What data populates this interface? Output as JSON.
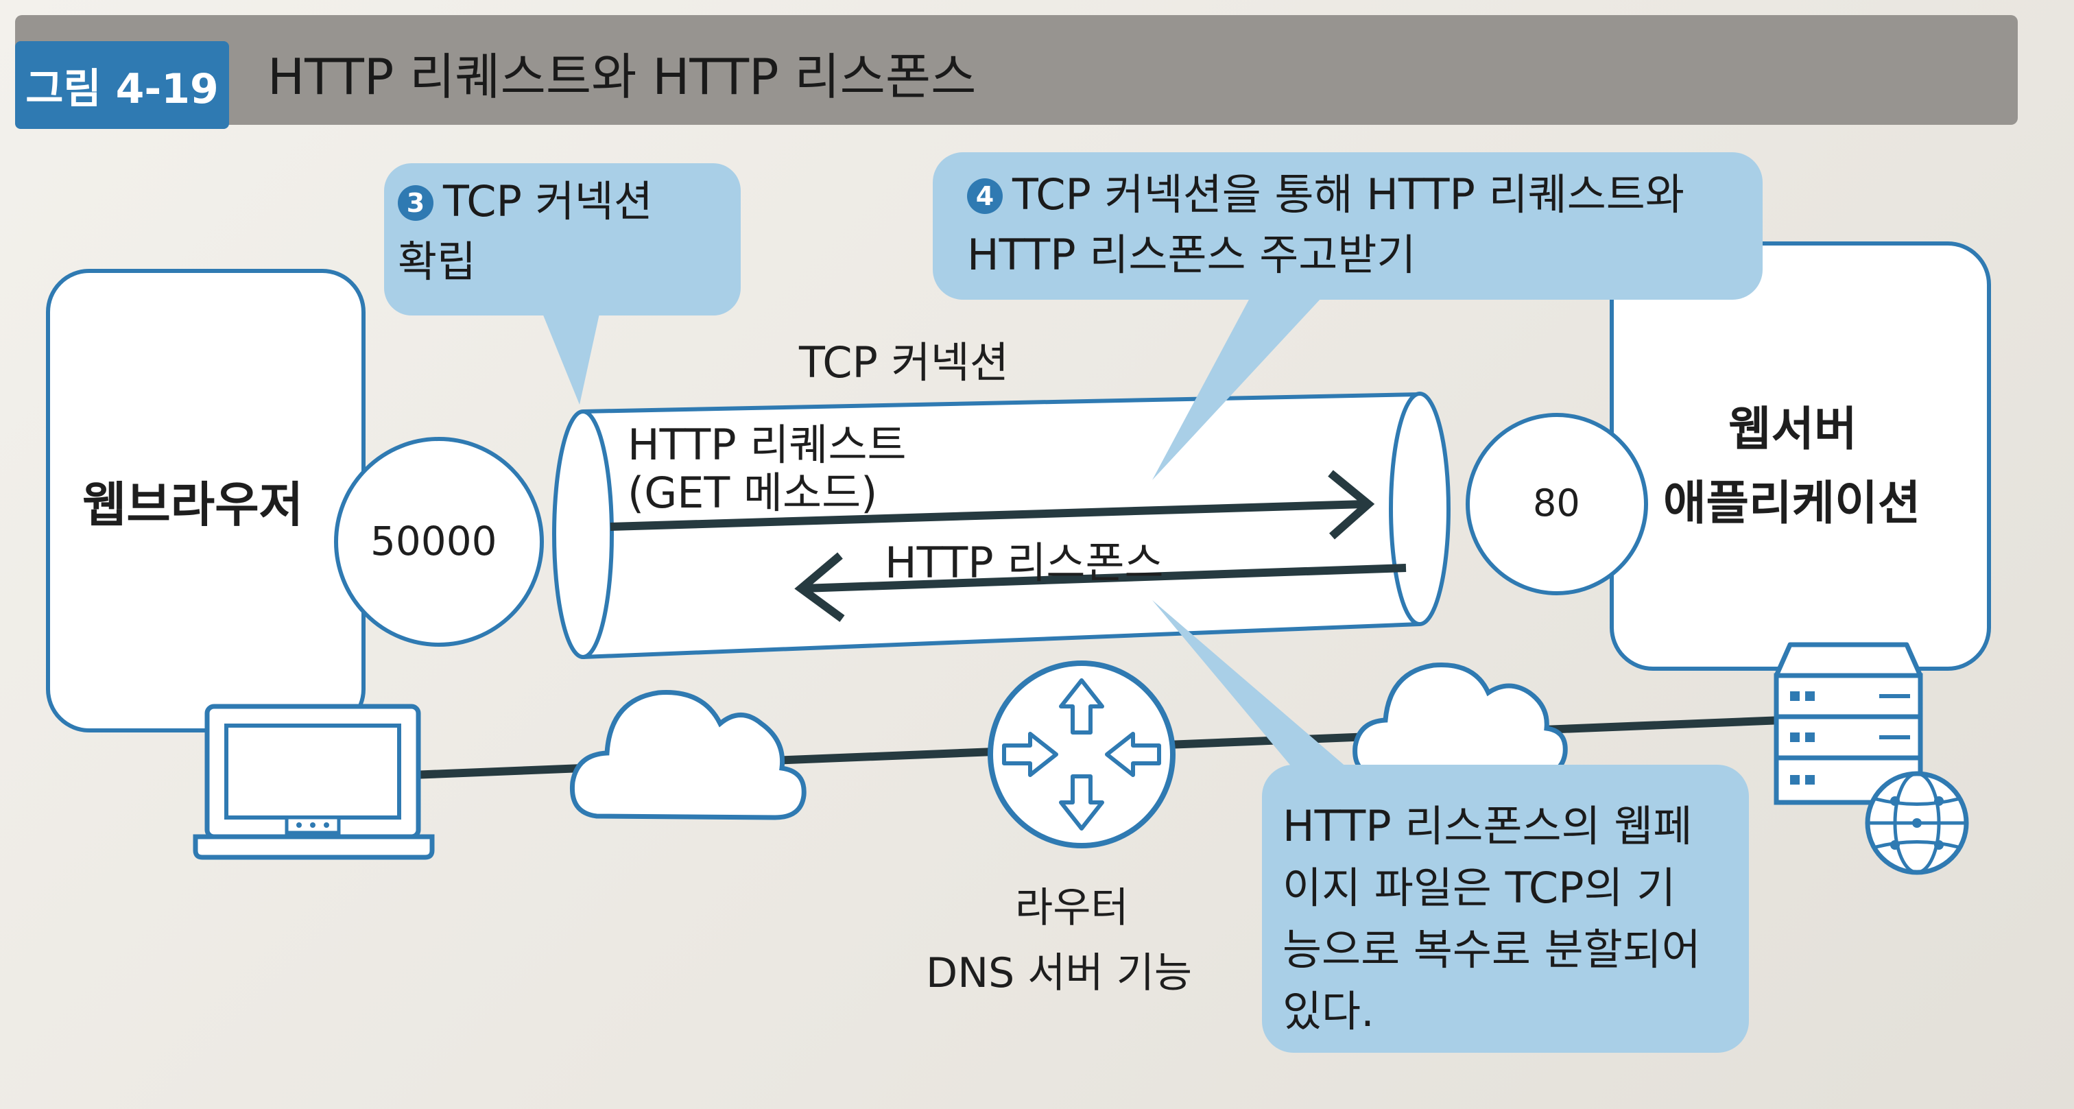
{
  "figure": {
    "label": "그림 4-19",
    "title": "HTTP 리퀘스트와 HTTP 리스폰스"
  },
  "browser": {
    "label": "웹브라우저",
    "port": "50000"
  },
  "server": {
    "label_line1": "웹서버",
    "label_line2": "애플리케이션",
    "port": "80"
  },
  "tunnel": {
    "label": "TCP 커넥션",
    "request_line1": "HTTP 리퀘스트",
    "request_line2": "(GET 메소드)",
    "response": "HTTP 리스폰스"
  },
  "router": {
    "line1": "라우터",
    "line2": "DNS 서버 기능"
  },
  "callouts": {
    "step3": {
      "number": "3",
      "line1": "TCP 커넥션",
      "line2": "확립"
    },
    "step4": {
      "number": "4",
      "line1": "TCP 커넥션을 통해 HTTP 리퀘스트와",
      "line2": "HTTP 리스폰스 주고받기"
    },
    "note": {
      "line1": "HTTP 리스폰스의 웹페",
      "line2": "이지 파일은 TCP의 기",
      "line3": "능으로 복수로 분할되어",
      "line4": "있다."
    }
  },
  "colors": {
    "accent": "#2f7ab2",
    "callout_fill": "#a9cfe7",
    "arrow": "#263a40",
    "title_bar": "#979490"
  },
  "icons": [
    "laptop-icon",
    "cloud-icon",
    "router-icon",
    "server-icon",
    "globe-icon"
  ]
}
